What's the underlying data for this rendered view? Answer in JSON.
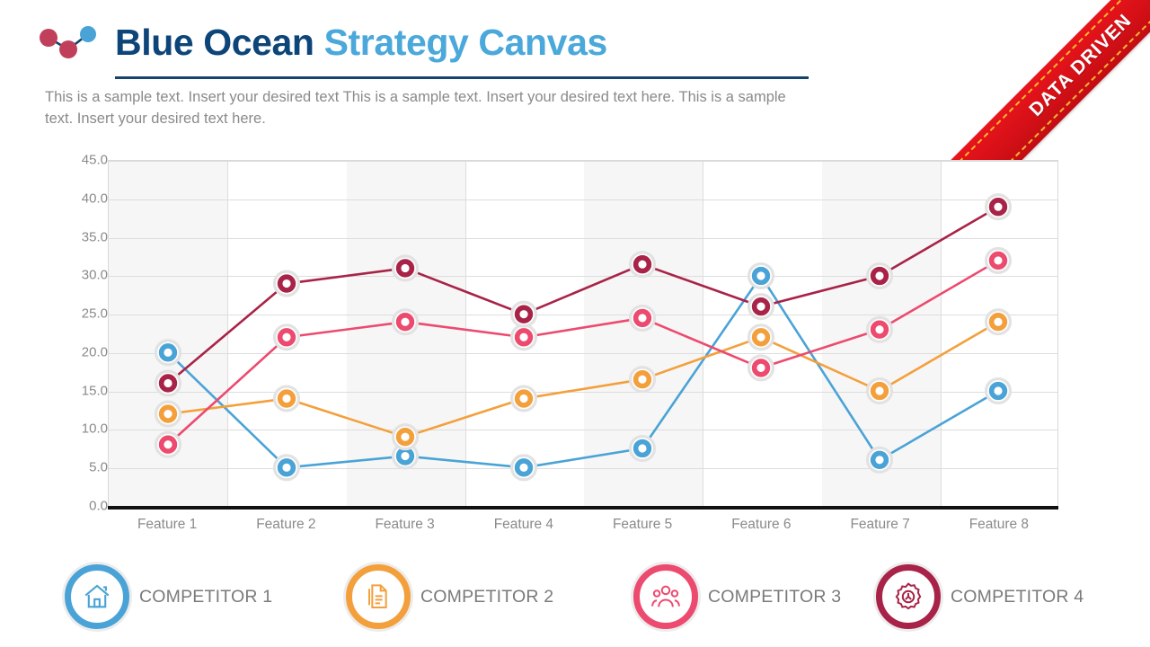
{
  "header": {
    "logo_icon": "line-chart-dots-logo",
    "title_part1": "Blue Ocean ",
    "title_part2": "Strategy Canvas",
    "subtitle": "This is a sample text. Insert your desired text This is a sample text. Insert your desired text here. This is a sample text. Insert your desired text here.",
    "title_color_primary": "#0d4579",
    "title_color_secondary": "#4aa8da"
  },
  "ribbon": {
    "text": "DATA DRIVEN",
    "color": "#d81017",
    "stitch_color": "#f7b733"
  },
  "legend": {
    "items": [
      {
        "label": "COMPETITOR 1",
        "color": "#4aa3d6",
        "icon": "house-icon"
      },
      {
        "label": "COMPETITOR 2",
        "color": "#f3a03c",
        "icon": "document-icon"
      },
      {
        "label": "COMPETITOR 3",
        "color": "#ec4a6e",
        "icon": "people-group-icon"
      },
      {
        "label": "COMPETITOR 4",
        "color": "#a82347",
        "icon": "gear-icon"
      }
    ]
  },
  "chart_data": {
    "type": "line",
    "title": "Blue Ocean Strategy Canvas",
    "xlabel": "",
    "ylabel": "",
    "ylim": [
      0,
      45
    ],
    "yticks": [
      "0.0",
      "5.0",
      "10.0",
      "15.0",
      "20.0",
      "25.0",
      "30.0",
      "35.0",
      "40.0",
      "45.0"
    ],
    "ytick_values": [
      0,
      5,
      10,
      15,
      20,
      25,
      30,
      35,
      40,
      45
    ],
    "grid": true,
    "legend_position": "bottom",
    "categories": [
      "Feature 1",
      "Feature 2",
      "Feature 3",
      "Feature 4",
      "Feature 5",
      "Feature 6",
      "Feature 7",
      "Feature 8"
    ],
    "series": [
      {
        "name": "COMPETITOR 1",
        "color": "#4aa3d6",
        "values": [
          20,
          5,
          6.5,
          5,
          7.5,
          30,
          6,
          15
        ]
      },
      {
        "name": "COMPETITOR 2",
        "color": "#f3a03c",
        "values": [
          12,
          14,
          9,
          14,
          16.5,
          22,
          15,
          24
        ]
      },
      {
        "name": "COMPETITOR 3",
        "color": "#ec4a6e",
        "values": [
          8,
          22,
          24,
          22,
          24.5,
          18,
          23,
          32
        ]
      },
      {
        "name": "COMPETITOR 4",
        "color": "#a82347",
        "values": [
          16,
          29,
          31,
          25,
          31.5,
          26,
          30,
          39
        ]
      }
    ]
  }
}
